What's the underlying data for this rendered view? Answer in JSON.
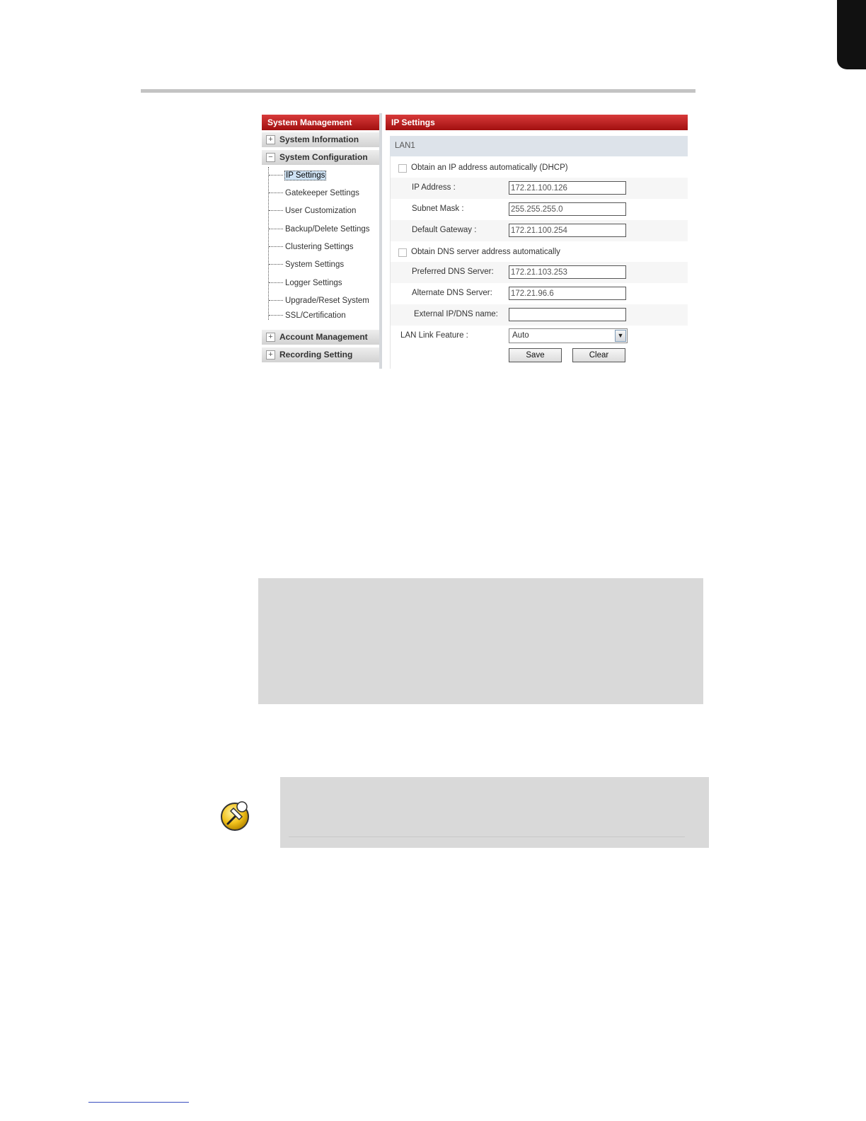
{
  "sidebar": {
    "header": "System Management",
    "sections": [
      {
        "label": "System Information",
        "toggle": "+"
      },
      {
        "label": "System Configuration",
        "toggle": "−"
      },
      {
        "label": "Account Management",
        "toggle": "+"
      },
      {
        "label": "Recording Setting",
        "toggle": "+"
      }
    ],
    "items": [
      "IP Settings",
      "Gatekeeper Settings",
      "User Customization",
      "Backup/Delete Settings",
      "Clustering Settings",
      "System Settings",
      "Logger Settings",
      "Upgrade/Reset System",
      "SSL/Certification"
    ],
    "active_item": "IP Settings"
  },
  "main": {
    "header": "IP Settings",
    "lan_label": "LAN1",
    "dhcp_label": "Obtain an IP address automatically (DHCP)",
    "ip_address": {
      "label": "IP Address :",
      "value": "172.21.100.126"
    },
    "subnet_mask": {
      "label": "Subnet Mask :",
      "value": "255.255.255.0"
    },
    "default_gateway": {
      "label": "Default Gateway :",
      "value": "172.21.100.254"
    },
    "dns_auto_label": "Obtain DNS server address automatically",
    "preferred_dns": {
      "label": "Preferred DNS Server:",
      "value": "172.21.103.253"
    },
    "alternate_dns": {
      "label": "Alternate DNS Server:",
      "value": "172.21.96.6"
    },
    "external_ip": {
      "label": "External IP/DNS name:",
      "value": ""
    },
    "lan_link": {
      "label": "LAN Link Feature :",
      "value": "Auto"
    },
    "save_label": "Save",
    "clear_label": "Clear"
  }
}
